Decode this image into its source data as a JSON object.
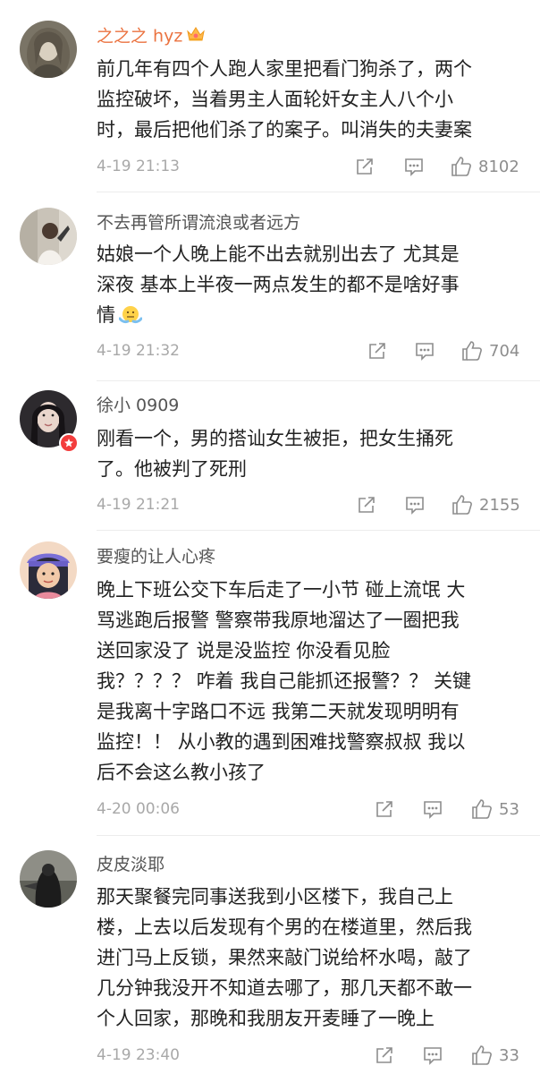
{
  "comments": [
    {
      "username": "之之之 hyz",
      "lines": [
        "前几年有四个人跑人家里把看门狗杀了，两个",
        "监控破坏，当着男主人面轮奸女主人八个小",
        "时，最后把他们杀了的案子。叫消失的夫妻案"
      ],
      "time": "4-19 21:13",
      "likes": "8102",
      "username_color": "#eb7340"
    },
    {
      "username": "不去再管所谓流浪或者远方",
      "lines": [
        "姑娘一个人晚上能不出去就别出去了  尤其是",
        "深夜  基本上半夜一两点发生的都不是啥好事",
        "情"
      ],
      "emoji": "shrug-emoji",
      "time": "4-19 21:32",
      "likes": "704"
    },
    {
      "username": "徐小 0909",
      "lines": [
        "刚看一个，男的搭讪女生被拒，把女生捅死",
        "了。他被判了死刑"
      ],
      "time": "4-19 21:21",
      "likes": "2155"
    },
    {
      "username": "要瘦的让人心疼",
      "lines": [
        "晚上下班公交下车后走了一小节  碰上流氓  大",
        "骂逃跑后报警  警察带我原地溜达了一圈把我",
        "送回家没了  说是没监控  你没看见脸",
        "我？？？？  咋着  我自己能抓还报警？？ 关键",
        "是我离十字路口不远  我第二天就发现明明有",
        "监控！！  从小教的遇到困难找警察叔叔  我以",
        "后不会这么教小孩了"
      ],
      "time": "4-20 00:06",
      "likes": "53"
    },
    {
      "username": "皮皮淡耶",
      "lines": [
        "那天聚餐完同事送我到小区楼下，我自己上",
        "楼，上去以后发现有个男的在楼道里，然后我",
        "进门马上反锁，果然来敲门说给杯水喝，敲了",
        "几分钟我没开不知道去哪了，那几天都不敢一",
        "个人回家，那晚和我朋友开麦睡了一晚上"
      ],
      "time": "4-19 23:40",
      "likes": "33"
    }
  ],
  "icons": {
    "share": "share-icon",
    "comment": "comment-icon",
    "like": "thumbs-up-icon",
    "crown": "crown-badge-icon",
    "verified": "verified-badge-icon"
  },
  "colors": {
    "text": "#222222",
    "username": "#555555",
    "time": "#a8a8a8",
    "icon": "#8d8d8d",
    "badge_red": "#f33d3d"
  }
}
